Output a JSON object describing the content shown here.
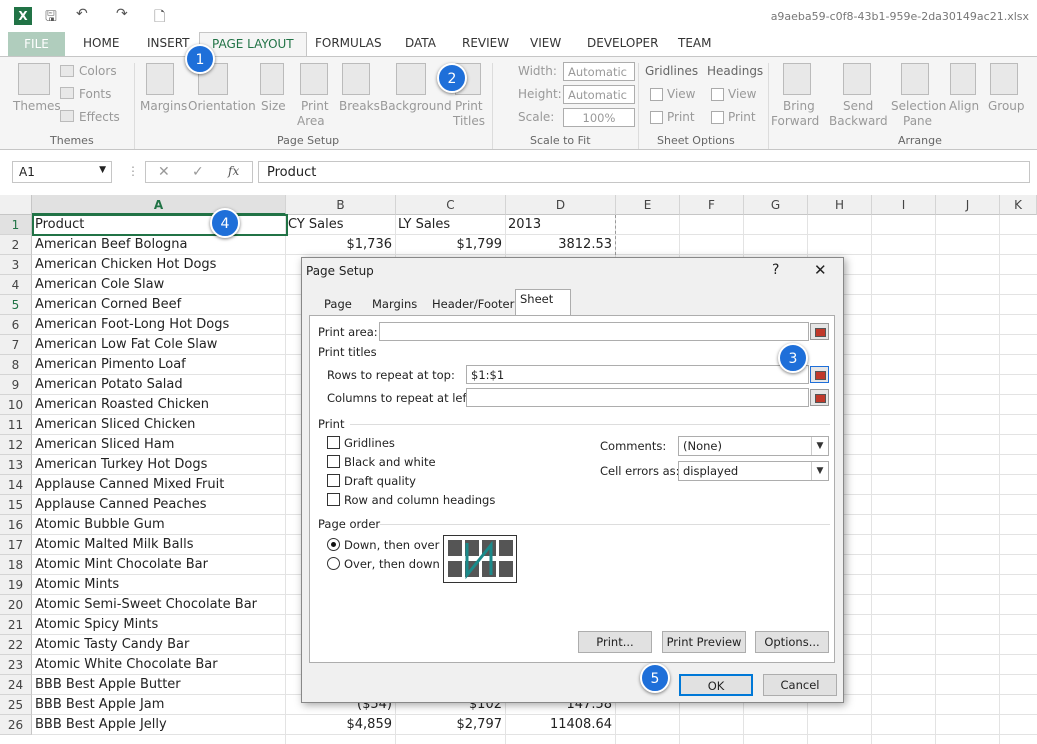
{
  "window": {
    "filename": "a9aeba59-c0f8-43b1-959e-2da30149ac21.xlsx"
  },
  "tabs": [
    "FILE",
    "HOME",
    "INSERT",
    "PAGE LAYOUT",
    "FORMULAS",
    "DATA",
    "REVIEW",
    "VIEW",
    "DEVELOPER",
    "TEAM"
  ],
  "ribbon": {
    "themes": {
      "themes": "Themes",
      "colors": "Colors",
      "fonts": "Fonts",
      "effects": "Effects",
      "group": "Themes"
    },
    "page_setup": {
      "margins": "Margins",
      "orientation": "Orientation",
      "size": "Size",
      "print_area1": "Print",
      "print_area2": "Area",
      "breaks": "Breaks",
      "background": "Background",
      "print_titles1": "Print",
      "print_titles2": "Titles",
      "group": "Page Setup"
    },
    "scale": {
      "width": "Width:",
      "width_val": "Automatic",
      "height": "Height:",
      "height_val": "Automatic",
      "scale": "Scale:",
      "scale_val": "100%",
      "group": "Scale to Fit"
    },
    "sheet_options": {
      "gridlines": "Gridlines",
      "headings": "Headings",
      "view": "View",
      "print": "Print",
      "group": "Sheet Options"
    },
    "arrange": {
      "bring1": "Bring",
      "bring2": "Forward",
      "send1": "Send",
      "send2": "Backward",
      "selection1": "Selection",
      "selection2": "Pane",
      "align": "Align",
      "group_btn": "Group",
      "group": "Arrange"
    }
  },
  "formula_bar": {
    "name_box": "A1",
    "content": "Product"
  },
  "columns": [
    "A",
    "B",
    "C",
    "D",
    "E",
    "F",
    "G",
    "H",
    "I",
    "J",
    "K"
  ],
  "rows": [
    {
      "n": "1",
      "a": "Product",
      "b": "CY Sales",
      "c": "LY Sales",
      "d": "2013"
    },
    {
      "n": "2",
      "a": "American Beef Bologna",
      "b": "$1,736",
      "c": "$1,799",
      "d": "3812.53"
    },
    {
      "n": "3",
      "a": "American Chicken Hot Dogs",
      "b": "",
      "c": "",
      "d": ""
    },
    {
      "n": "4",
      "a": "American Cole Slaw",
      "b": "",
      "c": "",
      "d": ""
    },
    {
      "n": "5",
      "a": "American Corned Beef",
      "b": "",
      "c": "",
      "d": ""
    },
    {
      "n": "6",
      "a": "American Foot-Long Hot Dogs",
      "b": "",
      "c": "",
      "d": ""
    },
    {
      "n": "7",
      "a": "American Low Fat Cole Slaw",
      "b": "",
      "c": "",
      "d": ""
    },
    {
      "n": "8",
      "a": "American Pimento Loaf",
      "b": "",
      "c": "",
      "d": ""
    },
    {
      "n": "9",
      "a": "American Potato Salad",
      "b": "",
      "c": "",
      "d": ""
    },
    {
      "n": "10",
      "a": "American Roasted Chicken",
      "b": "",
      "c": "",
      "d": ""
    },
    {
      "n": "11",
      "a": "American Sliced Chicken",
      "b": "",
      "c": "",
      "d": ""
    },
    {
      "n": "12",
      "a": "American Sliced Ham",
      "b": "",
      "c": "",
      "d": ""
    },
    {
      "n": "13",
      "a": "American Turkey Hot Dogs",
      "b": "",
      "c": "",
      "d": ""
    },
    {
      "n": "14",
      "a": "Applause Canned Mixed Fruit",
      "b": "",
      "c": "",
      "d": ""
    },
    {
      "n": "15",
      "a": "Applause Canned Peaches",
      "b": "",
      "c": "",
      "d": ""
    },
    {
      "n": "16",
      "a": "Atomic Bubble Gum",
      "b": "",
      "c": "",
      "d": ""
    },
    {
      "n": "17",
      "a": "Atomic Malted Milk Balls",
      "b": "",
      "c": "",
      "d": ""
    },
    {
      "n": "18",
      "a": "Atomic Mint Chocolate Bar",
      "b": "",
      "c": "",
      "d": ""
    },
    {
      "n": "19",
      "a": "Atomic Mints",
      "b": "",
      "c": "",
      "d": ""
    },
    {
      "n": "20",
      "a": "Atomic Semi-Sweet Chocolate Bar",
      "b": "",
      "c": "",
      "d": ""
    },
    {
      "n": "21",
      "a": "Atomic Spicy Mints",
      "b": "",
      "c": "",
      "d": ""
    },
    {
      "n": "22",
      "a": "Atomic Tasty Candy Bar",
      "b": "",
      "c": "",
      "d": ""
    },
    {
      "n": "23",
      "a": "Atomic White Chocolate Bar",
      "b": "",
      "c": "",
      "d": ""
    },
    {
      "n": "24",
      "a": "BBB Best Apple Butter",
      "b": "",
      "c": "",
      "d": ""
    },
    {
      "n": "25",
      "a": "BBB Best Apple Jam",
      "b": "($54)",
      "c": "$102",
      "d": "147.58"
    },
    {
      "n": "26",
      "a": "BBB Best Apple Jelly",
      "b": "$4,859",
      "c": "$2,797",
      "d": "11408.64"
    }
  ],
  "dialog": {
    "title": "Page Setup",
    "help": "?",
    "close": "✕",
    "tabs": [
      "Page",
      "Margins",
      "Header/Footer",
      "Sheet"
    ],
    "print_area": "Print area:",
    "print_area_val": "",
    "print_titles": "Print titles",
    "rows_repeat": "Rows to repeat at top:",
    "rows_repeat_val": "$1:$1",
    "cols_repeat": "Columns to repeat at left:",
    "cols_repeat_val": "",
    "print": "Print",
    "gridlines": "Gridlines",
    "bw": "Black and white",
    "draft": "Draft quality",
    "rowcol": "Row and column headings",
    "comments": "Comments:",
    "comments_val": "(None)",
    "errors": "Cell errors as:",
    "errors_val": "displayed",
    "page_order": "Page order",
    "down_over": "Down, then over",
    "over_down": "Over, then down",
    "btn_print": "Print...",
    "btn_preview": "Print Preview",
    "btn_options": "Options...",
    "ok": "OK",
    "cancel": "Cancel"
  },
  "callouts": [
    "1",
    "2",
    "3",
    "4",
    "5"
  ],
  "colors": {
    "accent": "#217346",
    "callout": "#1e6fd9"
  }
}
